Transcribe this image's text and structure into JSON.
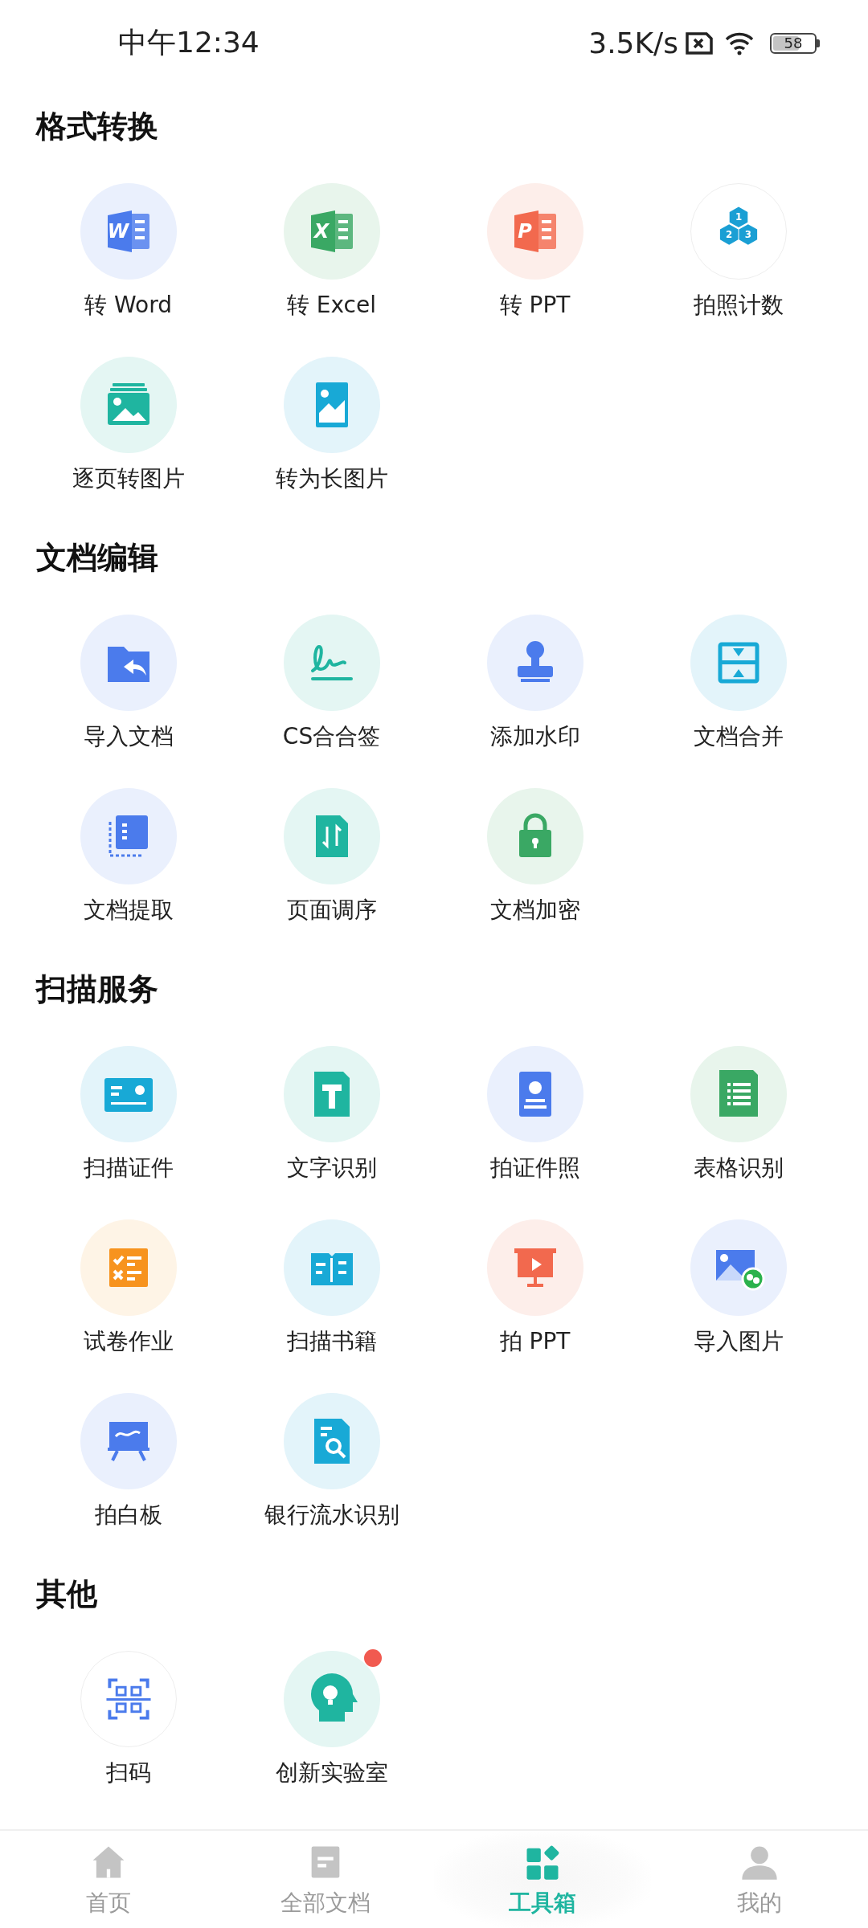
{
  "status_bar": {
    "time": "中午12:34",
    "net_speed": "3.5K/s",
    "battery": "58"
  },
  "sections": [
    {
      "title": "格式转换",
      "items": [
        {
          "label": "转 Word",
          "icon_text": [
            "W"
          ],
          "dot": false
        },
        {
          "label": "转 Excel",
          "icon_text": [
            "X"
          ],
          "dot": false
        },
        {
          "label": "转 PPT",
          "icon_text": [
            "P"
          ],
          "dot": false
        },
        {
          "label": "拍照计数",
          "icon_text": [
            "1",
            "2",
            "3"
          ],
          "dot": false
        },
        {
          "label": "逐页转图片",
          "dot": false
        },
        {
          "label": "转为长图片",
          "dot": false
        }
      ]
    },
    {
      "title": "文档编辑",
      "items": [
        {
          "label": "导入文档",
          "dot": false
        },
        {
          "label": "CS合合签",
          "dot": false
        },
        {
          "label": "添加水印",
          "dot": false
        },
        {
          "label": "文档合并",
          "dot": false
        },
        {
          "label": "文档提取",
          "dot": false
        },
        {
          "label": "页面调序",
          "dot": false
        },
        {
          "label": "文档加密",
          "dot": false
        }
      ]
    },
    {
      "title": "扫描服务",
      "items": [
        {
          "label": "扫描证件",
          "dot": false
        },
        {
          "label": "文字识别",
          "dot": false
        },
        {
          "label": "拍证件照",
          "dot": false
        },
        {
          "label": "表格识别",
          "dot": false
        },
        {
          "label": "试卷作业",
          "dot": false
        },
        {
          "label": "扫描书籍",
          "dot": false
        },
        {
          "label": "拍 PPT",
          "dot": false
        },
        {
          "label": "导入图片",
          "dot": false
        },
        {
          "label": "拍白板",
          "dot": false
        },
        {
          "label": "银行流水识别",
          "dot": false
        }
      ]
    },
    {
      "title": "其他",
      "items": [
        {
          "label": "扫码",
          "dot": false
        },
        {
          "label": "创新实验室",
          "dot": true
        }
      ]
    }
  ],
  "bottom_nav": [
    {
      "label": "首页",
      "selected": false
    },
    {
      "label": "全部文档",
      "selected": false
    },
    {
      "label": "工具箱",
      "selected": true
    },
    {
      "label": "我的",
      "selected": false
    }
  ]
}
